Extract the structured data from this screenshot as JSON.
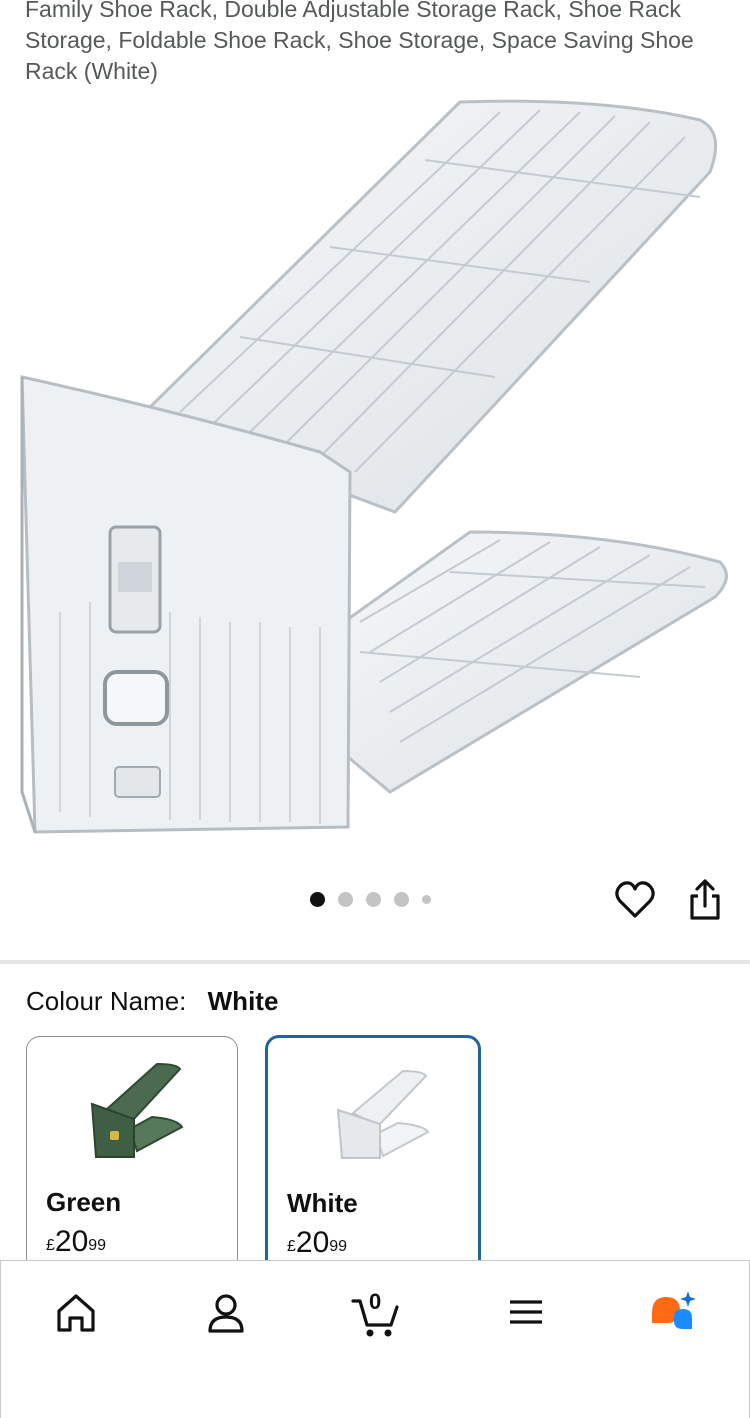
{
  "product": {
    "title": "Family Shoe Rack, Double Adjustable Storage Rack, Shoe Rack Storage, Foldable Shoe Rack, Shoe Storage, Space Saving Shoe Rack (White)"
  },
  "gallery": {
    "image_count": 5,
    "active_index": 0
  },
  "actions": {
    "wishlist_icon": "heart-outline-icon",
    "share_icon": "share-icon"
  },
  "variation": {
    "label": "Colour Name:",
    "selected": "White",
    "options": [
      {
        "name": "Green",
        "currency": "£",
        "price_whole": "20",
        "price_fraction": "99",
        "swatch_color": "#4a6b4f"
      },
      {
        "name": "White",
        "currency": "£",
        "price_whole": "20",
        "price_fraction": "99",
        "swatch_color": "#e8ecef"
      }
    ]
  },
  "bottom_nav": {
    "items": [
      {
        "name": "home",
        "icon": "home-icon"
      },
      {
        "name": "account",
        "icon": "person-icon"
      },
      {
        "name": "cart",
        "icon": "cart-icon",
        "count": "0"
      },
      {
        "name": "menu",
        "icon": "hamburger-menu-icon"
      },
      {
        "name": "rufus",
        "icon": "rufus-chat-icon"
      }
    ]
  },
  "colors": {
    "selected_border": "#2162a1",
    "rufus_orange": "#ff6a13",
    "rufus_blue": "#1a8cff"
  }
}
